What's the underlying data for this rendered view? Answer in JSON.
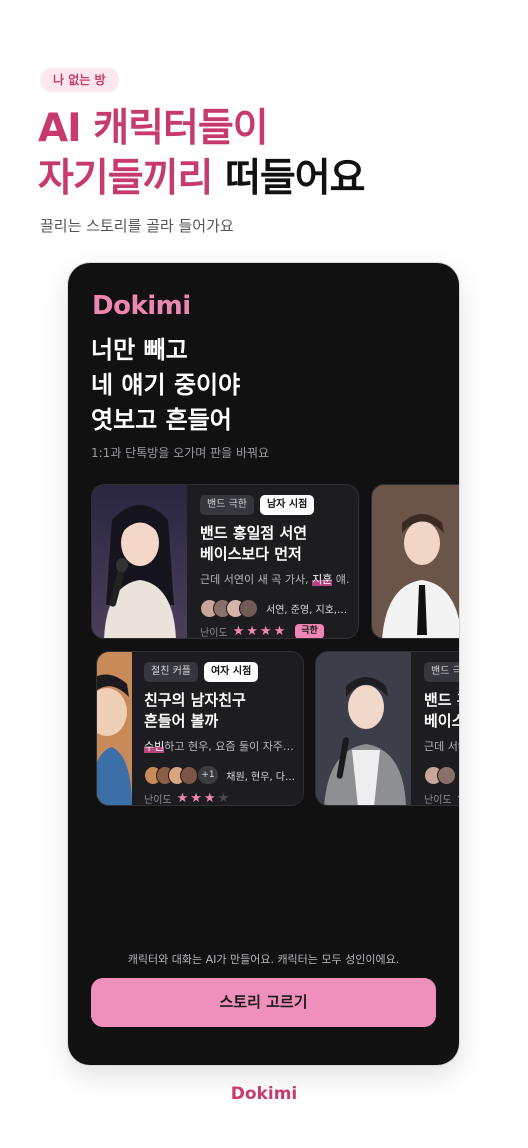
{
  "hero": {
    "badge": "나 없는 방",
    "headline_line1": "AI 캐릭터들이",
    "headline_line2_pink": "자기들끼리",
    "headline_line2_dark": "떠들어요",
    "subline": "끌리는 스토리를 골라 들어가요"
  },
  "app": {
    "logo": "Dokimi",
    "title_lines": [
      "너만 빼고",
      "네 얘기 중이야",
      "엿보고 흔들어"
    ],
    "subtitle": "1:1과 단톡방을 오가며 판을 바꿔요",
    "difficulty_label": "난이도",
    "note": "캐릭터와 대화는 AI가 만들어요. 캐릭터는 모두 성인이에요.",
    "cta": "스토리 고르기"
  },
  "cards": [
    {
      "tag1": "밴드 극한",
      "tag2": "남자 시점",
      "title1": "밴드 홍일점 서연",
      "title2": "베이스보다 먼저",
      "desc_pre": "근데 서연이 새 곡 가사, ",
      "desc_hl": "지훈",
      "desc_post": " 얘…",
      "names": "서연, 준영, 지호,…",
      "stars_on": 4,
      "stars_total": 4,
      "extreme": "극한"
    },
    {
      "tag1": "절친 커플",
      "tag2": "여자 시점",
      "title1": "친구의 남자친구",
      "title2": "흔들어 볼까",
      "desc_pre": "",
      "desc_hl": "수빈",
      "desc_post": "하고 현우, 요즘 둘이 자주…",
      "names": "채원, 현우, 다…",
      "plus": "+1",
      "stars_on": 3,
      "stars_total": 4
    },
    {
      "tag1": "밴드 극한",
      "title1": "밴드 홍일점 서연",
      "title2": "베이스보다 먼저",
      "desc_pre": "근데 서연이 새 곡 가사, ",
      "difficulty_label": "난이도"
    }
  ],
  "footer": {
    "logo": "Dokimi"
  },
  "colors": {
    "brand_pink": "#ef86b2",
    "headline_pink": "#c73a6d",
    "panel_bg": "#111112",
    "card_bg": "#1d1d21"
  }
}
